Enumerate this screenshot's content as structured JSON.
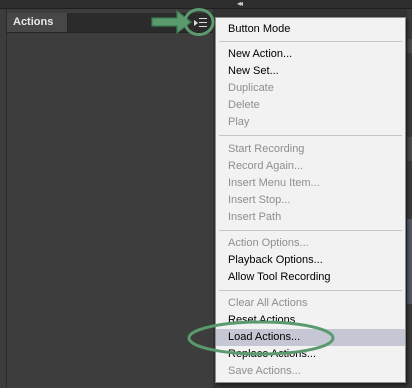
{
  "panel": {
    "title": "Actions"
  },
  "top_strip": {
    "collapse_glyph": "◂◂"
  },
  "menu": {
    "items": [
      {
        "label": "Button Mode",
        "enabled": true
      },
      {
        "label": "New Action...",
        "enabled": true
      },
      {
        "label": "New Set...",
        "enabled": true
      },
      {
        "label": "Duplicate",
        "enabled": false
      },
      {
        "label": "Delete",
        "enabled": false
      },
      {
        "label": "Play",
        "enabled": false
      },
      {
        "label": "Start Recording",
        "enabled": false
      },
      {
        "label": "Record Again...",
        "enabled": false
      },
      {
        "label": "Insert Menu Item...",
        "enabled": false
      },
      {
        "label": "Insert Stop...",
        "enabled": false
      },
      {
        "label": "Insert Path",
        "enabled": false
      },
      {
        "label": "Action Options...",
        "enabled": false
      },
      {
        "label": "Playback Options...",
        "enabled": true
      },
      {
        "label": "Allow Tool Recording",
        "enabled": true
      },
      {
        "label": "Clear All Actions",
        "enabled": false
      },
      {
        "label": "Reset Actions",
        "enabled": true
      },
      {
        "label": "Load Actions...",
        "enabled": true,
        "highlighted": true
      },
      {
        "label": "Replace Actions...",
        "enabled": true
      },
      {
        "label": "Save Actions...",
        "enabled": false
      }
    ]
  },
  "icons": {
    "panel_menu": "panel-flyout-menu-icon",
    "annotation_arrow": "green-arrow-icon",
    "annotation_ring": "green-ellipse-highlight"
  },
  "colors": {
    "annotation_green": "#5a9a6e",
    "menu_highlight": "#c5c8d4",
    "disabled_text": "#8e8e8e"
  }
}
